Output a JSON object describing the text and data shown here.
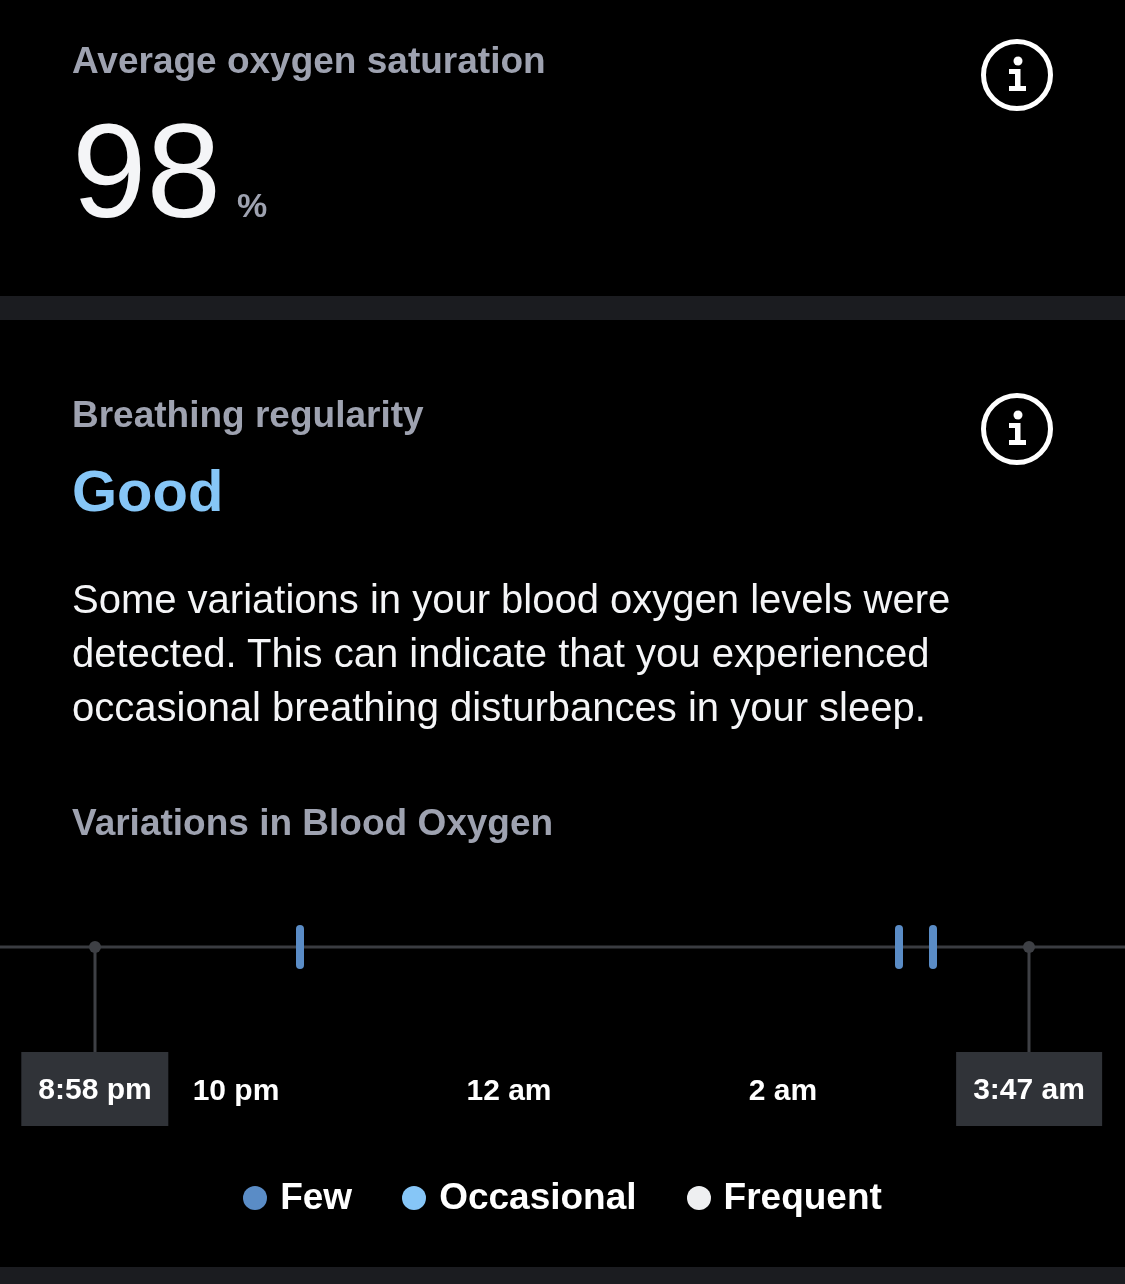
{
  "oxygen_saturation": {
    "title": "Average oxygen saturation",
    "value": "98",
    "unit": "%"
  },
  "breathing_regularity": {
    "title": "Breathing regularity",
    "rating": "Good",
    "description": "Some variations in your blood oxygen levels were detected. This can indicate that you experienced occasional breathing disturbances in your sleep.",
    "timeline": {
      "title": "Variations in Blood Oxygen",
      "start_time": "8:58 pm",
      "end_time": "3:47 am",
      "axis_labels": [
        "10 pm",
        "12 am",
        "2 am"
      ],
      "events": [
        {
          "color": "#5a8cc6"
        },
        {
          "color": "#5a8cc6"
        },
        {
          "color": "#5a8cc6"
        }
      ],
      "legend": [
        {
          "label": "Few",
          "color": "#5a8cc6"
        },
        {
          "label": "Occasional",
          "color": "#86c6f7"
        },
        {
          "label": "Frequent",
          "color": "#eeeff1"
        }
      ]
    }
  }
}
